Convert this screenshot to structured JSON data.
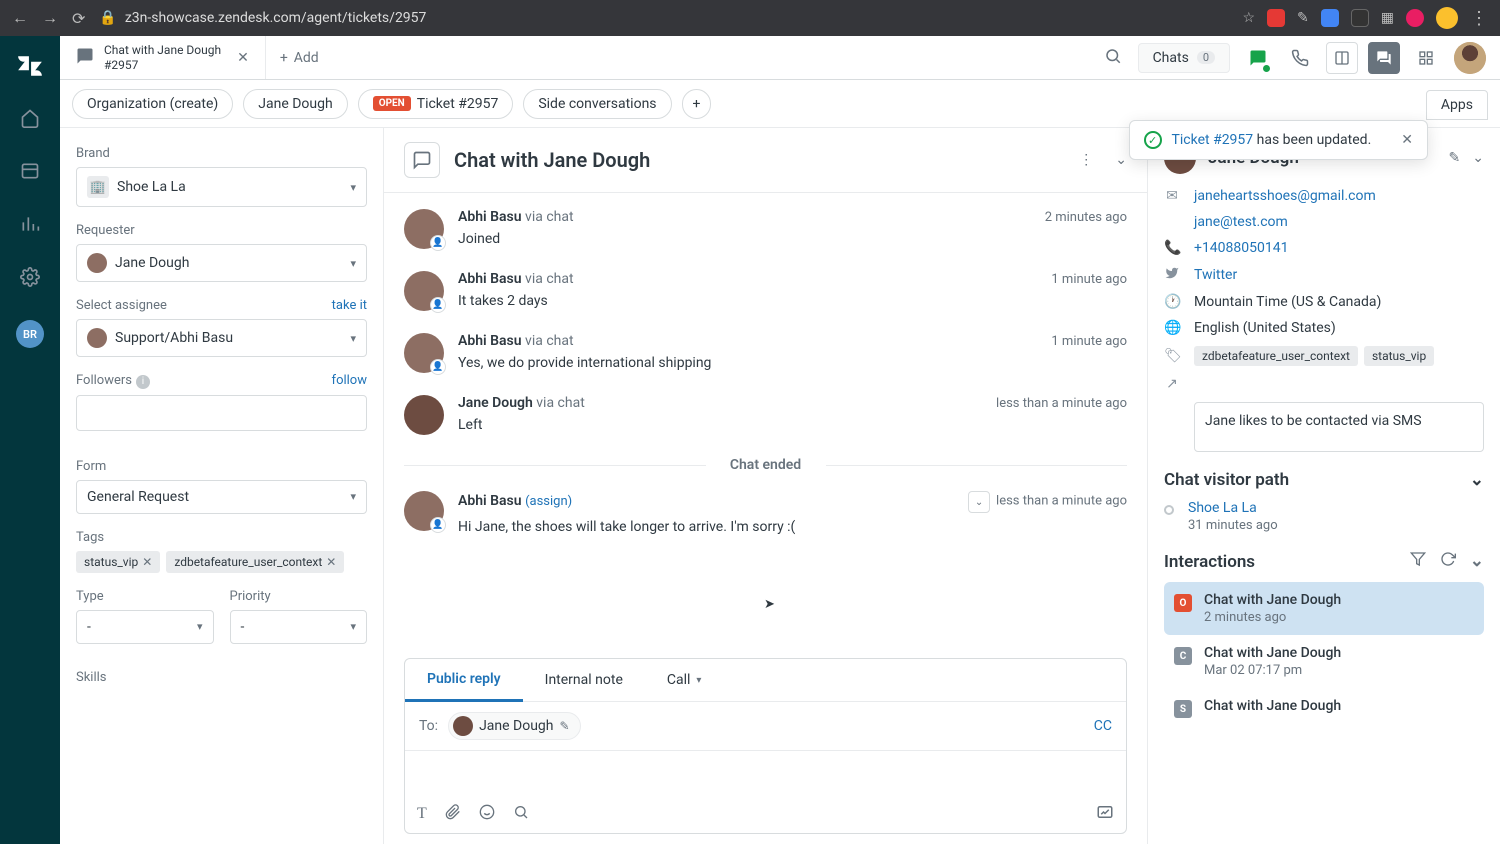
{
  "browser": {
    "url": "z3n-showcase.zendesk.com/agent/tickets/2957"
  },
  "topbar": {
    "tab_title": "Chat with Jane Dough",
    "tab_subtitle": "#2957",
    "add": "Add",
    "chats_label": "Chats",
    "chats_count": "0"
  },
  "subtabs": {
    "org": "Organization (create)",
    "user": "Jane Dough",
    "open": "OPEN",
    "ticket": "Ticket #2957",
    "side": "Side conversations",
    "apps": "Apps"
  },
  "toast": {
    "link": "Ticket #2957",
    "msg": " has been updated."
  },
  "leftnav": {
    "br": "BR"
  },
  "left": {
    "brand_label": "Brand",
    "brand": "Shoe La La",
    "requester_label": "Requester",
    "requester": "Jane Dough",
    "assignee_label": "Select assignee",
    "take_it": "take it",
    "assignee": "Support/Abhi Basu",
    "followers_label": "Followers",
    "follow": "follow",
    "form_label": "Form",
    "form": "General Request",
    "tags_label": "Tags",
    "tags": [
      "status_vip",
      "zdbetafeature_user_context"
    ],
    "type_label": "Type",
    "type": "-",
    "priority_label": "Priority",
    "priority": "-",
    "skills_label": "Skills"
  },
  "conv": {
    "title": "Chat with Jane Dough",
    "divider": "Chat ended",
    "messages": [
      {
        "name": "Abhi Basu",
        "via": " via chat",
        "time": "2 minutes ago",
        "text": "Joined"
      },
      {
        "name": "Abhi Basu",
        "via": " via chat",
        "time": "1 minute ago",
        "text": "It takes 2 days"
      },
      {
        "name": "Abhi Basu",
        "via": " via chat",
        "time": "1 minute ago",
        "text": "Yes, we do provide international shipping"
      },
      {
        "name": "Jane Dough",
        "via": " via chat",
        "time": "less than a minute ago",
        "text": "Left"
      }
    ],
    "after": {
      "name": "Abhi Basu",
      "assign": "(assign)",
      "time": "less than a minute ago",
      "text": "Hi Jane, the shoes will take longer to arrive. I'm sorry :("
    }
  },
  "composer": {
    "public": "Public reply",
    "internal": "Internal note",
    "call": "Call",
    "to": "To:",
    "to_name": "Jane Dough",
    "cc": "CC"
  },
  "right": {
    "name": "Jane Dough",
    "email1": "janeheartsshoes@gmail.com",
    "email2": "jane@test.com",
    "phone": "+14088050141",
    "twitter": "Twitter",
    "tz": "Mountain Time (US & Canada)",
    "lang": "English (United States)",
    "tags": [
      "zdbetafeature_user_context",
      "status_vip"
    ],
    "notes": "Jane likes to be contacted via SMS",
    "visitor_head": "Chat visitor path",
    "visit_link": "Shoe La La",
    "visit_sub": "31 minutes ago",
    "inter_head": "Interactions",
    "interactions": [
      {
        "badge": "O",
        "cls": "o",
        "title": "Chat with Jane Dough",
        "sub": "2 minutes ago",
        "active": true
      },
      {
        "badge": "C",
        "cls": "c",
        "title": "Chat with Jane Dough",
        "sub": "Mar 02 07:17 pm",
        "active": false
      },
      {
        "badge": "S",
        "cls": "s",
        "title": "Chat with Jane Dough",
        "sub": "",
        "active": false
      }
    ]
  }
}
